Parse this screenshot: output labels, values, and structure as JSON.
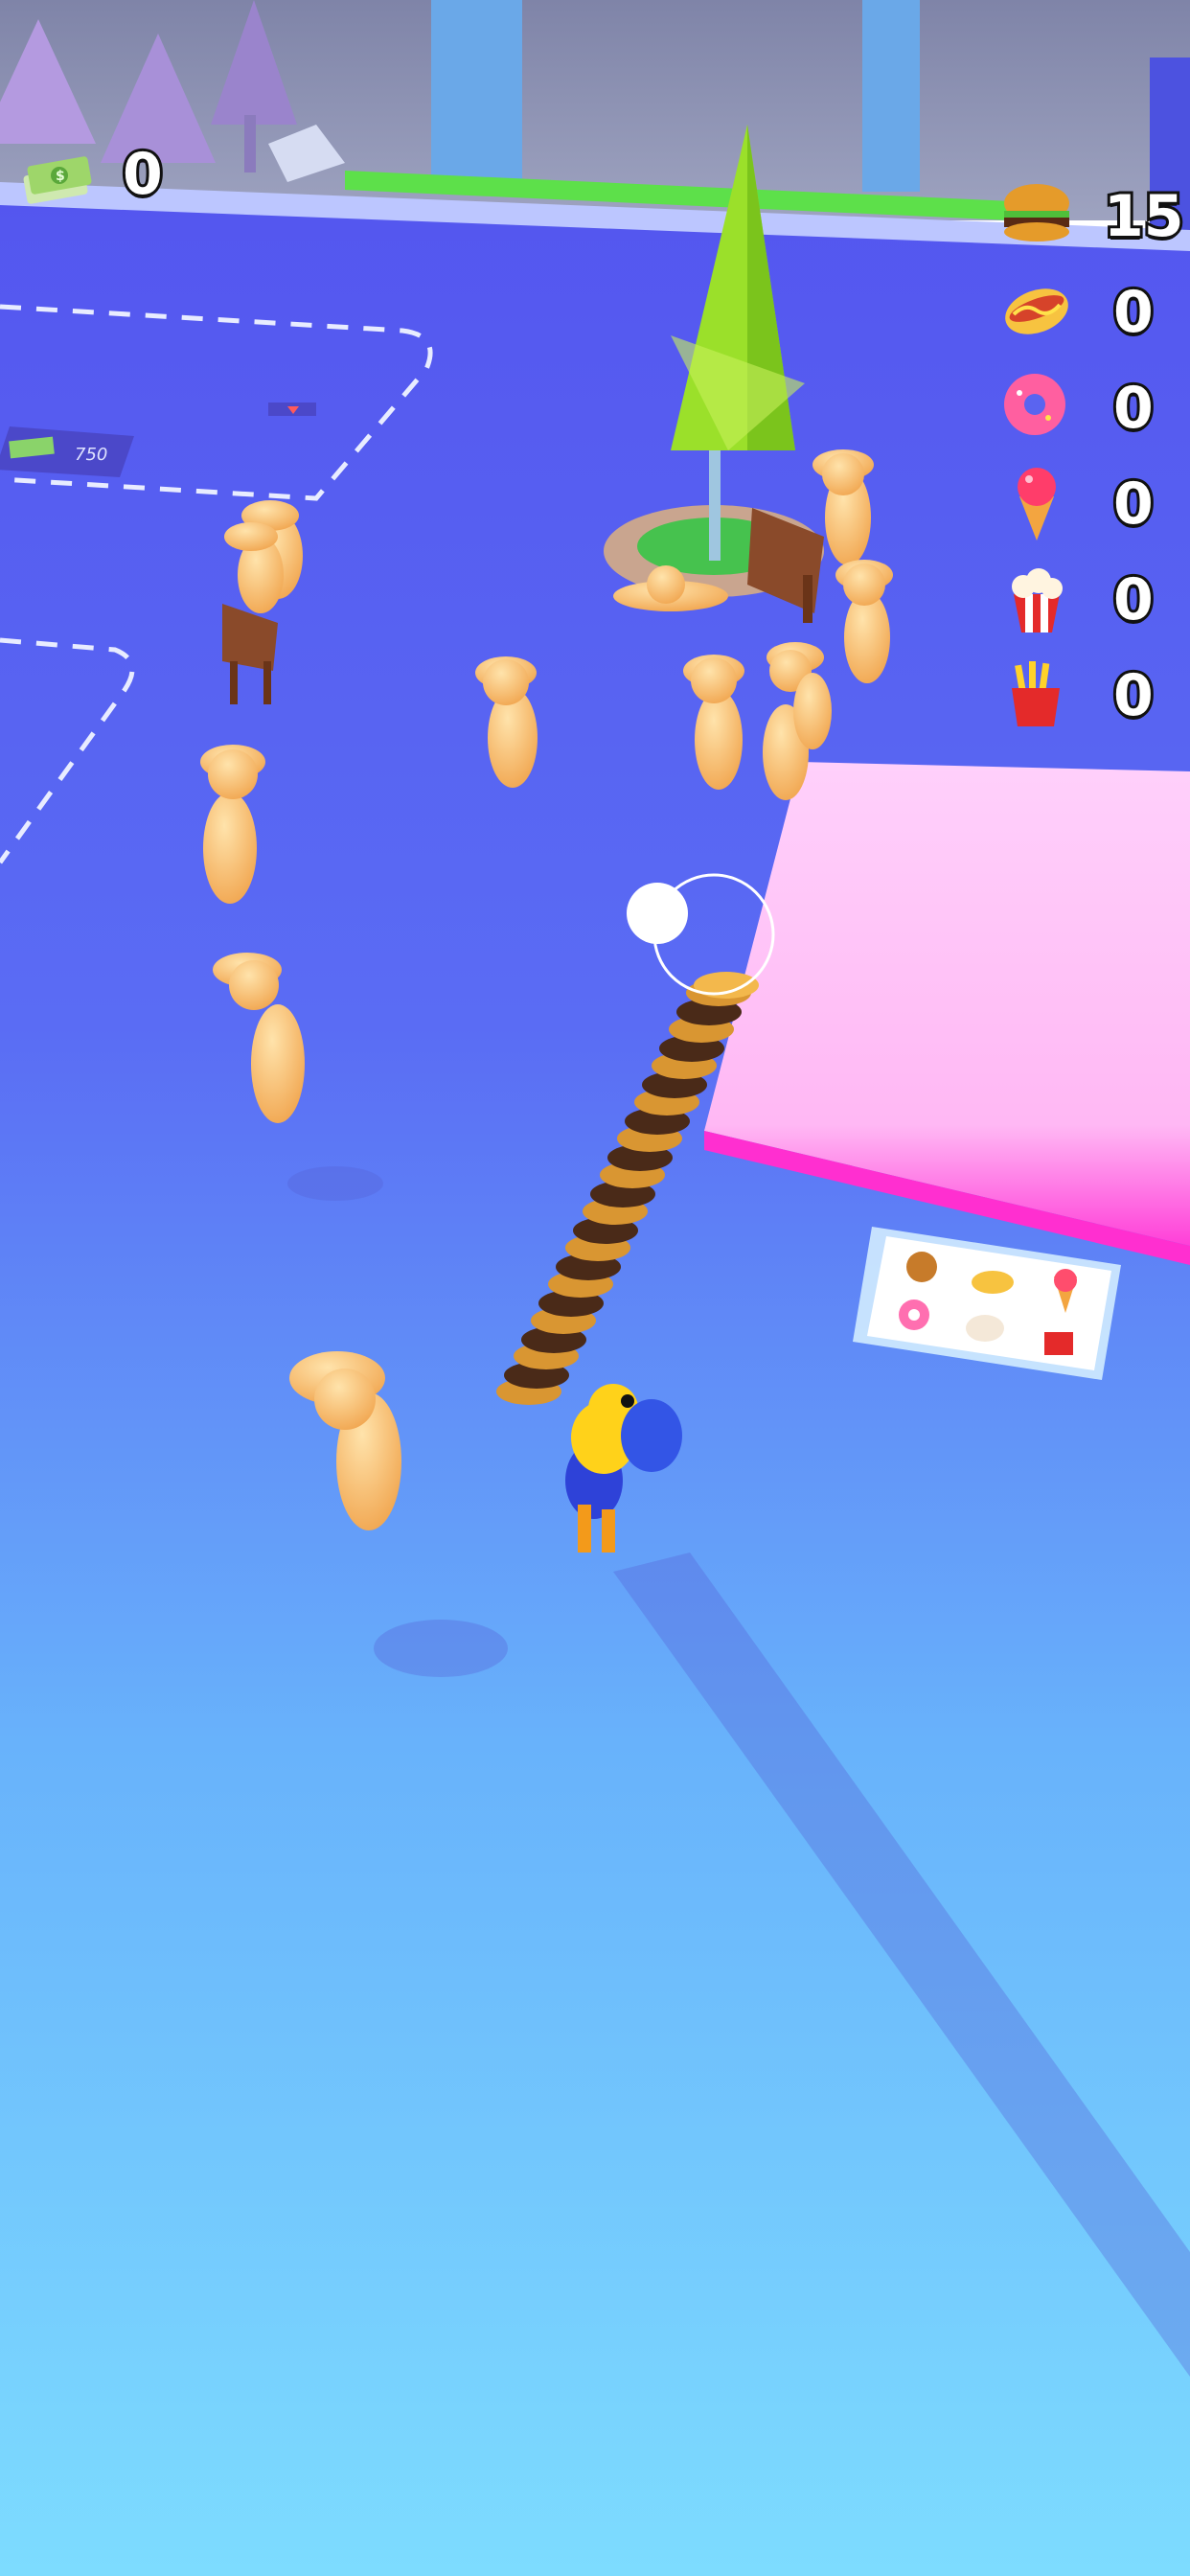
{
  "hud": {
    "cash": {
      "icon": "cash-stack-icon",
      "value": "0"
    },
    "inventory": [
      {
        "item": "burger",
        "icon": "burger-icon",
        "count": "15"
      },
      {
        "item": "hotdog",
        "icon": "hotdog-icon",
        "count": "0"
      },
      {
        "item": "donut",
        "icon": "donut-icon",
        "count": "0"
      },
      {
        "item": "ice-cream",
        "icon": "ice-cream-icon",
        "count": "0"
      },
      {
        "item": "popcorn",
        "icon": "popcorn-icon",
        "count": "0"
      },
      {
        "item": "fries",
        "icon": "fries-icon",
        "count": "0"
      }
    ]
  },
  "world": {
    "unlock_zone_price": "750",
    "colors": {
      "floor_top": "#5a5cf0",
      "floor_bottom": "#7ddcff",
      "counter": "#ffc4f8",
      "grass": "#5de04a",
      "customer": "#f2b45c"
    }
  }
}
